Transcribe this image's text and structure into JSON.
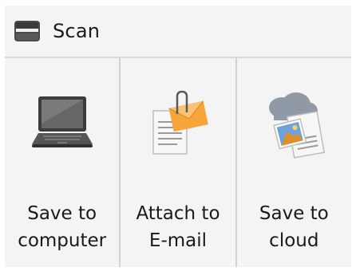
{
  "header": {
    "title": "Scan",
    "icon": "scanner-icon"
  },
  "tiles": [
    {
      "label": "Save to\ncomputer",
      "icon": "laptop-icon"
    },
    {
      "label": "Attach to\nE-mail",
      "icon": "envelope-document-icon"
    },
    {
      "label": "Save to\ncloud",
      "icon": "cloud-document-icon"
    }
  ],
  "colors": {
    "background": "#f4f4f4",
    "divider": "#d2d2d2",
    "envelope": "#f5a53a",
    "laptop": "#3d3d3d"
  }
}
